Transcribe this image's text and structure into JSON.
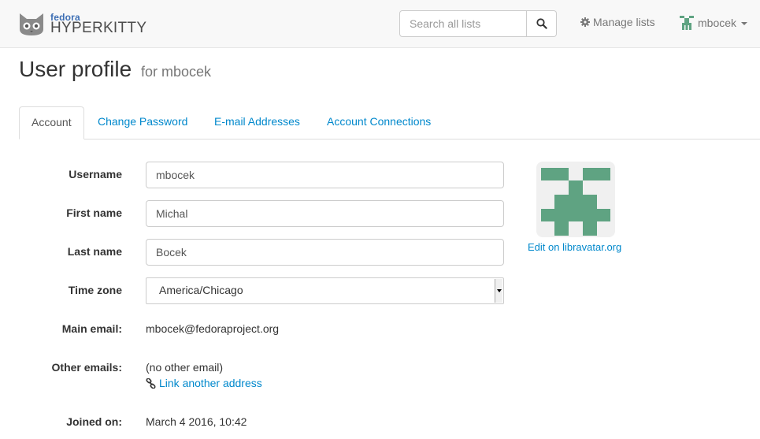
{
  "navbar": {
    "brand_top": "fedora",
    "brand_name": "HYPERKITTY",
    "search_placeholder": "Search all lists",
    "manage_lists": "Manage lists",
    "username": "mbocek"
  },
  "page": {
    "title": "User profile",
    "subtitle": "for mbocek"
  },
  "tabs": [
    {
      "label": "Account",
      "active": true
    },
    {
      "label": "Change Password",
      "active": false
    },
    {
      "label": "E-mail Addresses",
      "active": false
    },
    {
      "label": "Account Connections",
      "active": false
    }
  ],
  "form": {
    "username_label": "Username",
    "username_value": "mbocek",
    "first_name_label": "First name",
    "first_name_value": "Michal",
    "last_name_label": "Last name",
    "last_name_value": "Bocek",
    "timezone_label": "Time zone",
    "timezone_value": "America/Chicago",
    "main_email_label": "Main email:",
    "main_email_value": "mbocek@fedoraproject.org",
    "other_emails_label": "Other emails:",
    "other_emails_value": "(no other email)",
    "link_another": "Link another address",
    "joined_label": "Joined on:",
    "joined_value": "March 4 2016, 10:42"
  },
  "avatar": {
    "edit_link": "Edit on libravatar.org",
    "color": "#5fa382",
    "background": "#f0f0f0"
  },
  "icons": {
    "search": "search-icon",
    "gear": "gear-icon",
    "link": "link-icon",
    "caret": "caret-down-icon",
    "logo": "hyperkitty-cat-logo"
  },
  "colors": {
    "link": "#0088cc",
    "navbar_bg": "#f8f8f8",
    "fedora_blue": "#3c6eb4"
  }
}
